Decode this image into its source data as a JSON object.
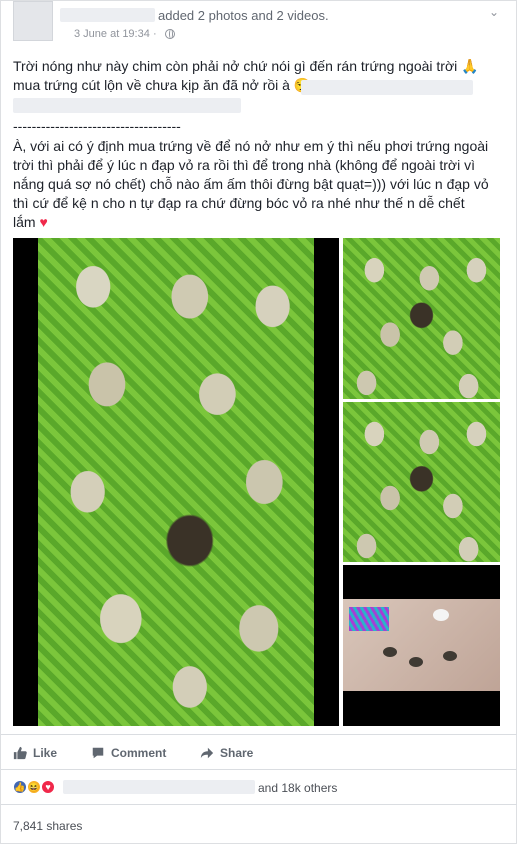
{
  "post": {
    "action_text": "added 2 photos and 2 videos.",
    "timestamp": "3 June at 19:34",
    "separator": "·",
    "lines": [
      "Trời nóng như này chim còn phải nở chứ nói gì đến rán trứng ngoài trời 🙏",
      "mua trứng cút lộn về chưa kịp ăn đã nở rồi à 😏",
      "------------------------------------",
      "À, với ai có ý định mua trứng về để nó nở như em ý thì nếu phơi trứng ngoài",
      "trời thì phải để ý lúc n đạp vỏ ra rồi thì để trong nhà (không để ngoài trời vì",
      "nắng quá sợ nó chết) chỗ nào ấm ấm thôi đừng bật quạt=))) với lúc n đạp vỏ",
      "thì cứ để kệ n cho n tự đạp ra chứ đừng bóc vỏ ra nhé như thế n dễ chết",
      "lắm"
    ],
    "heart": "♥"
  },
  "actions": {
    "like_label": "Like",
    "comment_label": "Comment",
    "share_label": "Share"
  },
  "reactions": {
    "count_text": "and 18k others"
  },
  "shares": {
    "text": "7,841 shares"
  },
  "icons": {
    "like": "thumbs-up-icon",
    "comment": "speech-bubble-icon",
    "share": "share-arrow-icon",
    "menu": "chevron-down-icon",
    "privacy": "globe-icon"
  },
  "colors": {
    "accent": "#4267b2",
    "love": "#f0284a",
    "haha": "#f7b125"
  }
}
